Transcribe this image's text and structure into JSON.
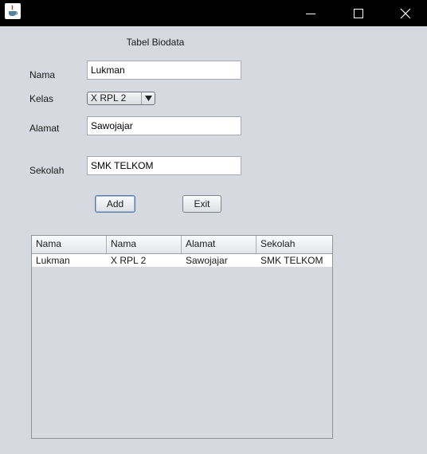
{
  "form": {
    "title": "Tabel Biodata",
    "nama_label": "Nama",
    "nama_value": "Lukman",
    "kelas_label": "Kelas",
    "kelas_value": "X RPL 2",
    "alamat_label": "Alamat",
    "alamat_value": "Sawojajar",
    "sekolah_label": "Sekolah",
    "sekolah_value": "SMK TELKOM",
    "add_label": "Add",
    "exit_label": "Exit"
  },
  "table": {
    "headers": [
      "Nama",
      "Nama",
      "Alamat",
      "Sekolah"
    ],
    "rows": [
      [
        "Lukman",
        "X RPL 2",
        "Sawojajar",
        "SMK TELKOM"
      ]
    ]
  },
  "icons": {
    "app": "java-cup-icon",
    "minimize": "minimize-icon",
    "maximize": "maximize-icon",
    "close": "close-icon",
    "combo_arrow": "triangle-down-icon"
  },
  "colors": {
    "titlebar": "#000000",
    "window_bg": "#d6d9df",
    "field_bg": "#ffffff"
  }
}
